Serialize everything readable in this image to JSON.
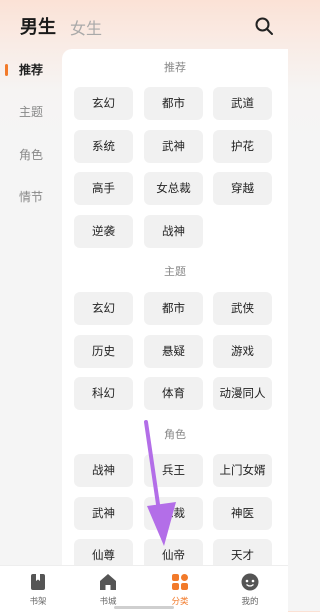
{
  "header": {
    "tab_male": "男生",
    "tab_female": "女生",
    "search_icon": "search-icon"
  },
  "sidebar": {
    "items": [
      "推荐",
      "主题",
      "角色",
      "情节"
    ],
    "active": "推荐"
  },
  "sections": {
    "recommend": {
      "title": "推荐",
      "chips": [
        "玄幻",
        "都市",
        "武道",
        "系统",
        "武神",
        "护花",
        "高手",
        "女总裁",
        "穿越",
        "逆袭",
        "战神"
      ]
    },
    "theme": {
      "title": "主题",
      "chips": [
        "玄幻",
        "都市",
        "武侠",
        "历史",
        "悬疑",
        "游戏",
        "科幻",
        "体育",
        "动漫同人"
      ]
    },
    "role": {
      "title": "角色",
      "chips": [
        "战神",
        "兵王",
        "上门女婿",
        "武神",
        "总裁",
        "神医",
        "仙尊",
        "仙帝",
        "天才"
      ]
    }
  },
  "bottom_nav": {
    "items": [
      {
        "label": "书架",
        "icon": "bookshelf-icon"
      },
      {
        "label": "书城",
        "icon": "home-icon"
      },
      {
        "label": "分类",
        "icon": "category-grid-icon"
      },
      {
        "label": "我的",
        "icon": "profile-icon"
      }
    ],
    "active": "分类"
  },
  "colors": {
    "accent": "#f27a2a",
    "annotation_arrow": "#b36ee8"
  }
}
